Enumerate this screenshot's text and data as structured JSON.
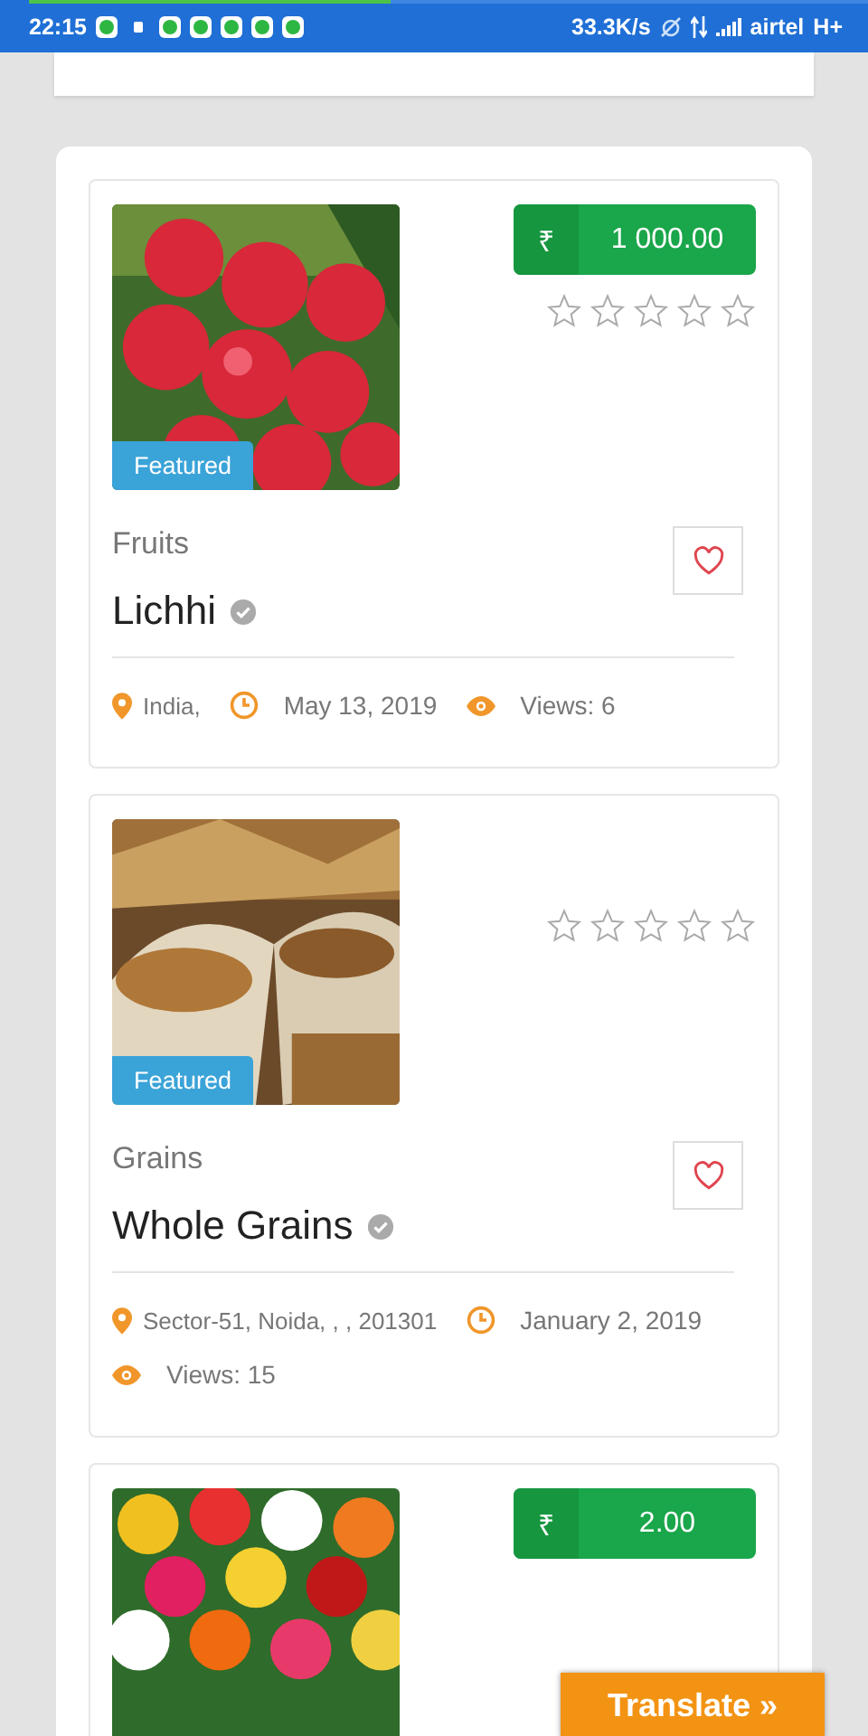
{
  "status_bar": {
    "time": "22:15",
    "load_progress": {
      "level": 0.43
    },
    "notifications": [
      {
        "kind": "app"
      },
      {
        "kind": "dot"
      },
      {
        "kind": "app"
      },
      {
        "kind": "app"
      },
      {
        "kind": "app"
      },
      {
        "kind": "app"
      },
      {
        "kind": "app"
      }
    ],
    "speed": "33.3K/s",
    "carrier": "airtel",
    "network": "H+"
  },
  "listings": [
    {
      "price": {
        "currency": "₹",
        "amount": "1 000.00"
      },
      "stars": 0,
      "badge": "Featured",
      "category": "Fruits",
      "title": "Lichhi",
      "verified": true,
      "location": "India,",
      "date": "May 13, 2019",
      "views": "Views: 6"
    },
    {
      "stars": 0,
      "badge": "Featured",
      "category": "Grains",
      "title": "Whole Grains",
      "verified": true,
      "location": "Sector-51, Noida, , , 201301",
      "date": "January 2, 2019",
      "views": "Views: 15"
    },
    {
      "price": {
        "currency": "₹",
        "amount": "2.00"
      }
    }
  ],
  "translate_button": "Translate »"
}
